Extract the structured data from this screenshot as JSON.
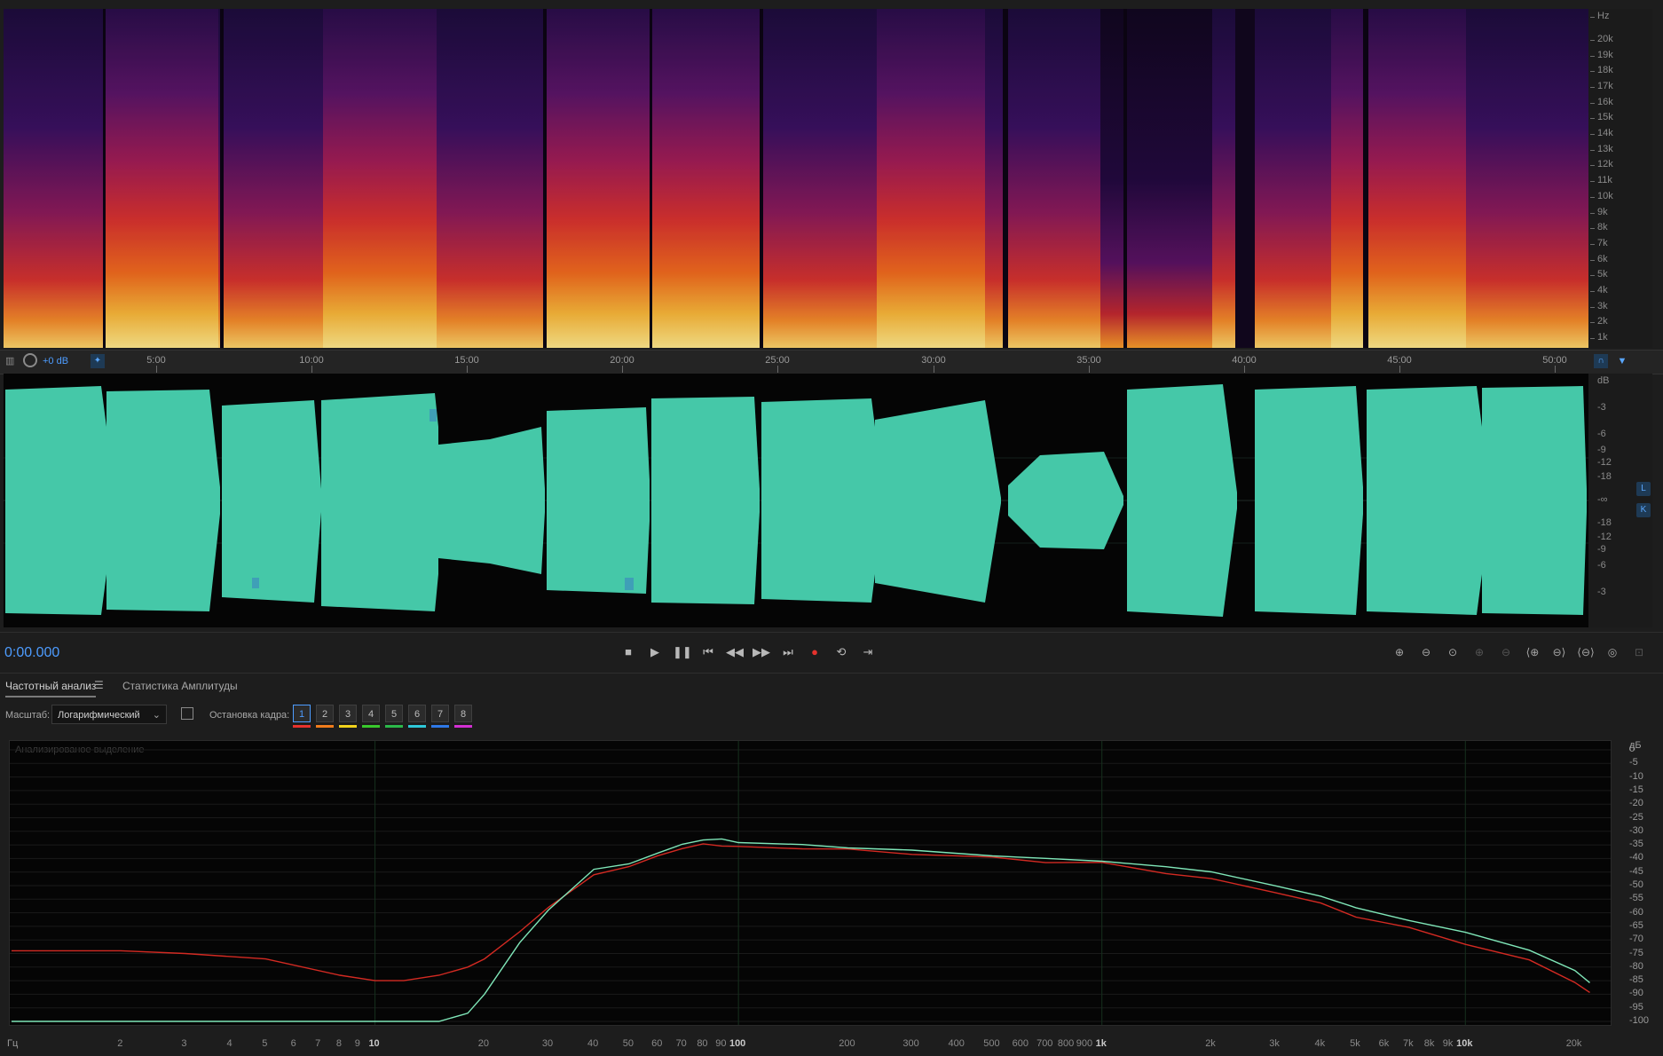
{
  "spectrogram": {
    "unit_label": "Hz",
    "freq_ticks": [
      "20k",
      "19k",
      "18k",
      "17k",
      "16k",
      "15k",
      "14k",
      "13k",
      "12k",
      "11k",
      "10k",
      "9k",
      "8k",
      "7k",
      "6k",
      "5k",
      "4k",
      "3k",
      "2k",
      "1k"
    ]
  },
  "timeline": {
    "gain_label": "+0 dB",
    "time_labels": [
      "5:00",
      "10:00",
      "15:00",
      "20:00",
      "25:00",
      "30:00",
      "35:00",
      "40:00",
      "45:00",
      "50:00"
    ]
  },
  "waveform": {
    "unit_label": "dB",
    "db_ticks": [
      "-3",
      "-6",
      "-9",
      "-12",
      "-18",
      "-∞",
      "-18",
      "-12",
      "-9",
      "-6",
      "-3"
    ],
    "channel_top": "L",
    "channel_bottom": "K",
    "color": "#45c8a8"
  },
  "transport": {
    "timecode": "0:00.000",
    "record_color": "#e5322d"
  },
  "panel": {
    "tabs": [
      {
        "label": "Частотный анализ",
        "active": true
      },
      {
        "label": "Статистика Амплитуды",
        "active": false
      }
    ],
    "scale_label": "Масштаб:",
    "scale_value": "Логарифмический",
    "freeze_label": "Остановка кадра:",
    "frames": [
      {
        "n": "1",
        "color": "#e5322d"
      },
      {
        "n": "2",
        "color": "#f07c1c"
      },
      {
        "n": "3",
        "color": "#f1d21c"
      },
      {
        "n": "4",
        "color": "#39c92c"
      },
      {
        "n": "5",
        "color": "#2bb84a"
      },
      {
        "n": "6",
        "color": "#2ec8d8"
      },
      {
        "n": "7",
        "color": "#2e78e6"
      },
      {
        "n": "8",
        "color": "#d22fd2"
      }
    ],
    "analyzed_selection": "Анализированое выделение"
  },
  "chart_data": {
    "type": "line",
    "y_unit": "дБ",
    "x_unit": "Гц",
    "x_ticks": [
      "2",
      "3",
      "4",
      "5",
      "6",
      "7",
      "8",
      "9",
      "10",
      "20",
      "30",
      "40",
      "50",
      "60",
      "70",
      "80",
      "90",
      "100",
      "200",
      "300",
      "400",
      "500",
      "600",
      "700",
      "800",
      "900",
      "1k",
      "2k",
      "3k",
      "4k",
      "5k",
      "6k",
      "7k",
      "8k",
      "9k",
      "10k",
      "20k"
    ],
    "y_ticks": [
      "0",
      "-5",
      "-10",
      "-15",
      "-20",
      "-25",
      "-30",
      "-35",
      "-40",
      "-45",
      "-50",
      "-55",
      "-60",
      "-65",
      "-70",
      "-75",
      "-80",
      "-85",
      "-90",
      "-95",
      "-100"
    ],
    "ylim": [
      -100,
      0
    ],
    "xlim_hz": [
      1,
      24000
    ],
    "scale": "log",
    "grid": true,
    "series": [
      {
        "color": "#d32a22",
        "x": [
          1,
          2,
          3,
          5,
          8,
          10,
          12,
          15,
          18,
          20,
          25,
          30,
          40,
          50,
          60,
          70,
          80,
          90,
          100,
          150,
          200,
          300,
          500,
          700,
          1000,
          1500,
          2000,
          3000,
          4000,
          5000,
          7000,
          10000,
          15000,
          20000,
          22000
        ],
        "y": [
          -74,
          -74,
          -75,
          -77,
          -83,
          -85,
          -85,
          -83,
          -80,
          -77,
          -67,
          -58,
          -46,
          -43,
          -39,
          -36,
          -35,
          -35,
          -36,
          -36,
          -37,
          -38,
          -40,
          -41,
          -42,
          -45,
          -48,
          -52,
          -57,
          -61,
          -66,
          -71,
          -78,
          -85,
          -90
        ]
      },
      {
        "color": "#7fe6b8",
        "x": [
          1,
          2,
          3,
          5,
          8,
          10,
          12,
          15,
          18,
          20,
          25,
          30,
          40,
          50,
          60,
          70,
          80,
          90,
          100,
          150,
          200,
          300,
          500,
          700,
          1000,
          1500,
          2000,
          3000,
          4000,
          5000,
          7000,
          10000,
          15000,
          20000,
          22000
        ],
        "y": [
          -100,
          -100,
          -100,
          -100,
          -100,
          -100,
          -100,
          -100,
          -97,
          -90,
          -71,
          -59,
          -44,
          -42,
          -38,
          -35,
          -33,
          -33,
          -34,
          -35,
          -36,
          -37,
          -39,
          -40,
          -41,
          -43,
          -45,
          -50,
          -54,
          -58,
          -63,
          -67,
          -74,
          -81,
          -86
        ]
      }
    ]
  }
}
